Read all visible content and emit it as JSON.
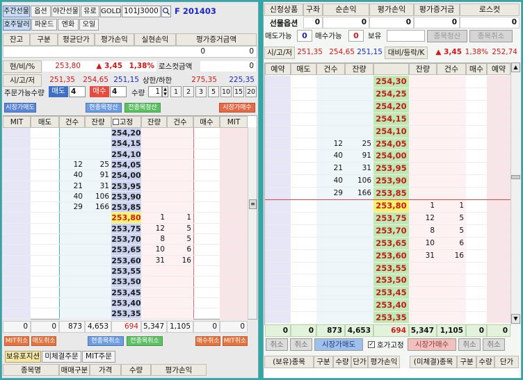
{
  "left": {
    "tabs_row1": [
      "주간선물",
      "옵션",
      "야간선물",
      "유로",
      "GOLD"
    ],
    "code_value": "101J3000",
    "product_label": "F 201403",
    "tabs_row2": [
      "호주달러",
      "파운드",
      "엔화",
      "오일"
    ],
    "balance_headers": [
      "잔고",
      "구분",
      "평균단가",
      "평가손익",
      "실현손익",
      "평가증거금액"
    ],
    "balance_values": [
      "0",
      "0"
    ],
    "rate_label": "현/비/%",
    "rate_price": "253,80",
    "rate_change": "▲ 3,45",
    "rate_pct": "1,38%",
    "losscut_label": "로스컷금액",
    "losscut_value": "0",
    "ohl_label": "시/고/저",
    "ohl_values": [
      "251,35",
      "254,65",
      "251,15"
    ],
    "limit_label": "상한/하한",
    "limit_up": "275,35",
    "limit_down": "225,35",
    "order_qty_label": "주문가능수량",
    "sell_label": "매도",
    "sell_qty": "4",
    "buy_label": "매수",
    "buy_qty": "4",
    "qty_label": "수량",
    "qty_value": "1",
    "qty_buttons": [
      "1",
      "2",
      "3",
      "5",
      "10",
      "15",
      "20"
    ],
    "market_sell": "시장가매도",
    "current_clear": "현종목청산",
    "all_clear": "전종목청산",
    "market_buy": "시장가매수",
    "grid_headers": [
      "MIT",
      "매도",
      "건수",
      "잔량",
      "고정",
      "잔량",
      "건수",
      "매수",
      "MIT"
    ],
    "prices": [
      "254,20",
      "254,15",
      "254,10",
      "254,05",
      "254,00",
      "253,95",
      "253,90",
      "253,85",
      "253,80",
      "253,75",
      "253,70",
      "253,65",
      "253,60",
      "253,55",
      "253,50",
      "253,45",
      "253,40",
      "253,35"
    ],
    "ask_counts": [
      "",
      "",
      "",
      "12",
      "40",
      "21",
      "40",
      "29",
      "",
      "",
      "",
      "",
      "",
      "",
      "",
      "",
      "",
      ""
    ],
    "ask_qty": [
      "",
      "",
      "",
      "25",
      "91",
      "31",
      "106",
      "166",
      "",
      "",
      "",
      "",
      "",
      "",
      "",
      "",
      "",
      ""
    ],
    "bid_qty": [
      "",
      "",
      "",
      "",
      "",
      "",
      "",
      "",
      "1",
      "12",
      "8",
      "10",
      "31",
      "",
      "",
      "",
      "",
      ""
    ],
    "bid_counts": [
      "",
      "",
      "",
      "",
      "",
      "",
      "",
      "",
      "1",
      "5",
      "5",
      "6",
      "16",
      "",
      "",
      "",
      "",
      ""
    ],
    "totals": [
      "0",
      "0",
      "873",
      "4,653",
      "694",
      "5,347",
      "1,105",
      "0",
      "0"
    ],
    "bottom_buttons": [
      "MIT취소",
      "매도취소",
      "현종목취소",
      "전종목취소",
      "매수취소",
      "MIT취소"
    ],
    "bottom_tabs": [
      "보유포지션",
      "미체결주문",
      "MIT주문"
    ],
    "pos_headers": [
      "종목명",
      "매매구분",
      "가격",
      "수량",
      "평가손익"
    ]
  },
  "right": {
    "head1": [
      "신청상품",
      "구좌",
      "순손익",
      "평가손익",
      "평가증거금",
      "로스컷"
    ],
    "product": "선물옵션",
    "head1_values": [
      "0",
      "0",
      "0",
      "0",
      "0"
    ],
    "sellable_label": "매도가능",
    "sellable": "0",
    "buyable_label": "매수가능",
    "buyable": "0",
    "hold_label": "보유",
    "clear_btn": "종목청산",
    "cancel_btn": "종목취소",
    "ohl_label": "시/고/저",
    "ohl_values": [
      "251,35",
      "254,65",
      "251,15"
    ],
    "compare_label": "대비/등락/K",
    "change": "▲ 3,45",
    "pct": "1,38%",
    "k": "252,74",
    "grid_headers": [
      "예약",
      "매도",
      "건수",
      "잔량",
      "",
      "잔량",
      "건수",
      "매수",
      "예약"
    ],
    "prices": [
      "254,30",
      "254,25",
      "254,20",
      "254,15",
      "254,10",
      "254,05",
      "254,00",
      "253,95",
      "253,90",
      "253,85",
      "253,80",
      "253,75",
      "253,70",
      "253,65",
      "253,60",
      "253,55",
      "253,50",
      "253,45",
      "253,40",
      "253,35"
    ],
    "ask_counts": [
      "",
      "",
      "",
      "",
      "",
      "12",
      "40",
      "21",
      "40",
      "29",
      "",
      "",
      "",
      "",
      "",
      "",
      "",
      "",
      "",
      ""
    ],
    "ask_qty": [
      "",
      "",
      "",
      "",
      "",
      "25",
      "91",
      "31",
      "106",
      "166",
      "",
      "",
      "",
      "",
      "",
      "",
      "",
      "",
      "",
      ""
    ],
    "bid_qty": [
      "",
      "",
      "",
      "",
      "",
      "",
      "",
      "",
      "",
      "",
      "1",
      "12",
      "8",
      "10",
      "31",
      "",
      "",
      "",
      "",
      ""
    ],
    "bid_counts": [
      "",
      "",
      "",
      "",
      "",
      "",
      "",
      "",
      "",
      "",
      "1",
      "5",
      "5",
      "6",
      "16",
      "",
      "",
      "",
      "",
      ""
    ],
    "totals": [
      "0",
      "0",
      "873",
      "4,653",
      "694",
      "5,347",
      "1,105",
      "0",
      "0"
    ],
    "btn_cancel": "취소",
    "market_sell": "시장가매도",
    "fixed_label": "호가고정",
    "market_buy": "시장가매수",
    "pos_headers_left": [
      "(보유)종목",
      "구분",
      "수량",
      "단가",
      "평가손익"
    ],
    "pos_headers_right": [
      "(미체결)종목",
      "구분",
      "수량",
      "단가"
    ]
  }
}
